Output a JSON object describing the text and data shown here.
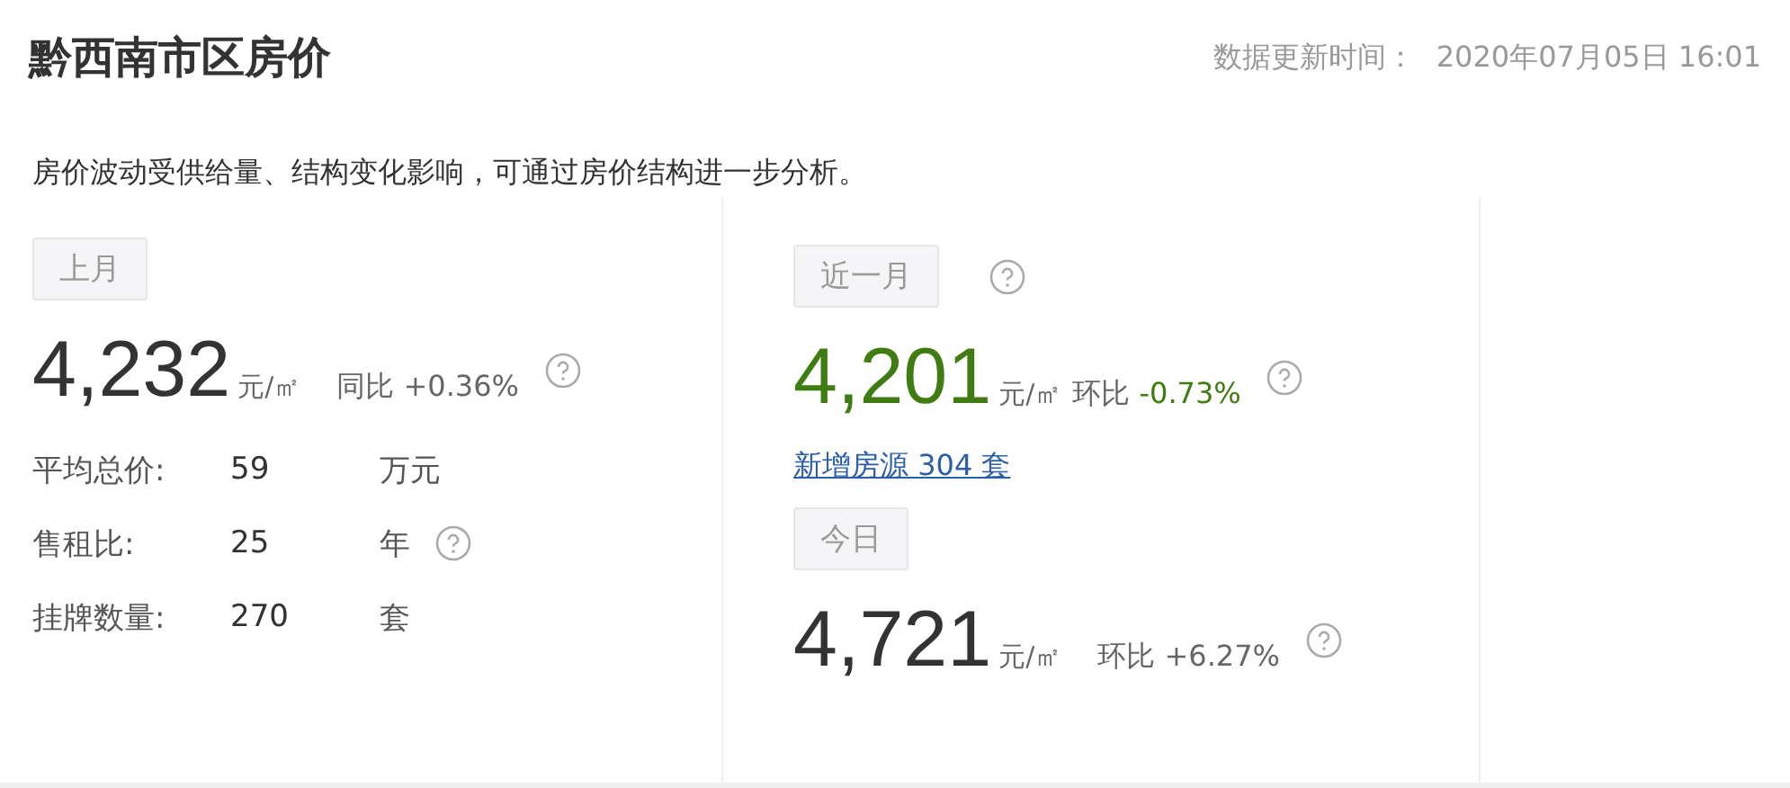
{
  "title": "黔西南市区房价",
  "update": {
    "label": "数据更新时间：",
    "value": "2020年07月05日 16:01"
  },
  "description": "房价波动受供给量、结构变化影响，可通过房价结构进一步分析。",
  "last_month": {
    "tag": "上月",
    "price": "4,232",
    "unit": "元/㎡",
    "change_label": "同比",
    "change": "+0.36%",
    "falling": false,
    "stats": [
      {
        "label": "平均总价:",
        "value": "59",
        "unit": "万元",
        "help": false
      },
      {
        "label": "售租比:",
        "value": "25",
        "unit": "年",
        "help": true
      },
      {
        "label": "挂牌数量:",
        "value": "270",
        "unit": "套",
        "help": false
      }
    ]
  },
  "recent_month": {
    "tag": "近一月",
    "price": "4,201",
    "unit": "元/㎡",
    "change_label": "环比",
    "change": "-0.73%",
    "falling": true,
    "link": "新增房源 304 套"
  },
  "today": {
    "tag": "今日",
    "price": "4,721",
    "unit": "元/㎡",
    "change_label": "环比",
    "change": "+6.27%",
    "falling": false
  }
}
